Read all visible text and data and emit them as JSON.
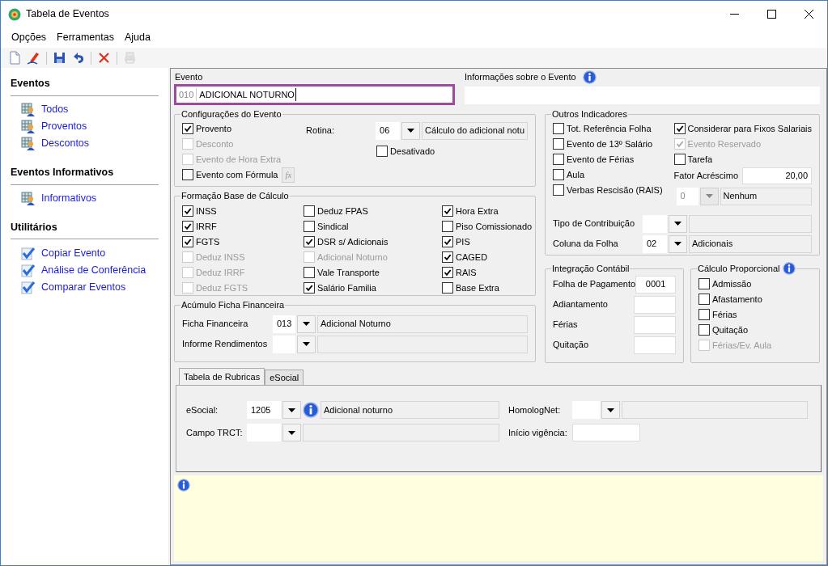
{
  "window": {
    "title": "Tabela de Eventos"
  },
  "menu": [
    "Opções",
    "Ferramentas",
    "Ajuda"
  ],
  "toolbar": [
    {
      "kind": "new",
      "disabled": false
    },
    {
      "kind": "edit",
      "disabled": false
    },
    {
      "kind": "sep"
    },
    {
      "kind": "save",
      "disabled": false
    },
    {
      "kind": "undo",
      "disabled": false
    },
    {
      "kind": "sep"
    },
    {
      "kind": "delete",
      "disabled": false
    },
    {
      "kind": "sep"
    },
    {
      "kind": "print",
      "disabled": true
    }
  ],
  "sidebar": {
    "sections": [
      {
        "title": "Eventos",
        "items": [
          {
            "label": "Todos",
            "kind": "table"
          },
          {
            "label": "Proventos",
            "kind": "table"
          },
          {
            "label": "Descontos",
            "kind": "table"
          }
        ]
      },
      {
        "title": "Eventos Informativos",
        "items": [
          {
            "label": "Informativos",
            "kind": "table"
          }
        ]
      },
      {
        "title": "Utilitários",
        "items": [
          {
            "label": "Copiar Evento",
            "kind": "check"
          },
          {
            "label": "Análise de Conferência",
            "kind": "check"
          },
          {
            "label": "Comparar Eventos",
            "kind": "check"
          }
        ]
      }
    ]
  },
  "evento": {
    "label": "Evento",
    "code": "010",
    "name": "ADICIONAL NOTURNO"
  },
  "info": {
    "label": "Informações sobre o Evento"
  },
  "config": {
    "title": "Configurações do Evento",
    "checkboxes": [
      {
        "label": "Provento",
        "checked": true,
        "disabled": false
      },
      {
        "label": "Desconto",
        "checked": false,
        "disabled": true
      },
      {
        "label": "Evento de Hora Extra",
        "checked": false,
        "disabled": true
      },
      {
        "label": "Evento com Fórmula",
        "checked": false,
        "disabled": false
      }
    ],
    "formula_button": "fx",
    "rotina": {
      "label": "Rotina:",
      "code": "06",
      "description": "Cálculo do adicional notu"
    },
    "desativado": {
      "label": "Desativado",
      "checked": false,
      "disabled": false
    }
  },
  "base": {
    "title": "Formação Base de Cálculo",
    "columns": [
      [
        {
          "label": "INSS",
          "checked": true,
          "disabled": false
        },
        {
          "label": "IRRF",
          "checked": true,
          "disabled": false
        },
        {
          "label": "FGTS",
          "checked": true,
          "disabled": false
        },
        {
          "label": "Deduz INSS",
          "checked": false,
          "disabled": true
        },
        {
          "label": "Deduz IRRF",
          "checked": false,
          "disabled": true
        },
        {
          "label": "Deduz FGTS",
          "checked": false,
          "disabled": true
        }
      ],
      [
        {
          "label": "Deduz FPAS",
          "checked": false,
          "disabled": false
        },
        {
          "label": "Sindical",
          "checked": false,
          "disabled": false
        },
        {
          "label": "DSR s/ Adicionais",
          "checked": true,
          "disabled": false
        },
        {
          "label": "Adicional Noturno",
          "checked": false,
          "disabled": true
        },
        {
          "label": "Vale Transporte",
          "checked": false,
          "disabled": false
        },
        {
          "label": "Salário Familia",
          "checked": true,
          "disabled": false
        }
      ],
      [
        {
          "label": "Hora Extra",
          "checked": true,
          "disabled": false
        },
        {
          "label": "Piso Comissionado",
          "checked": false,
          "disabled": false
        },
        {
          "label": "PIS",
          "checked": true,
          "disabled": false
        },
        {
          "label": "CAGED",
          "checked": true,
          "disabled": false
        },
        {
          "label": "RAIS",
          "checked": true,
          "disabled": false
        },
        {
          "label": "Base Extra",
          "checked": false,
          "disabled": false
        }
      ]
    ]
  },
  "acumulo": {
    "title": "Acúmulo Ficha Financeira",
    "rows": [
      {
        "label": "Ficha Financeira",
        "code": "013",
        "description": "Adicional Noturno"
      },
      {
        "label": "Informe Rendimentos"
      }
    ]
  },
  "outros": {
    "title": "Outros Indicadores",
    "left": [
      {
        "label": "Tot. Referência Folha",
        "checked": false,
        "disabled": false
      },
      {
        "label": "Evento de 13º Salário",
        "checked": false,
        "disabled": false
      },
      {
        "label": "Evento de Férias",
        "checked": false,
        "disabled": false
      },
      {
        "label": "Aula",
        "checked": false,
        "disabled": false
      },
      {
        "label": "Verbas Rescisão (RAIS)",
        "checked": false,
        "disabled": false
      }
    ],
    "right": [
      {
        "label": "Considerar para Fixos Salariais",
        "checked": true,
        "disabled": false
      },
      {
        "label": "Evento Reservado",
        "checked": true,
        "disabled": true
      },
      {
        "label": "Tarefa",
        "checked": false,
        "disabled": false
      }
    ],
    "fator": {
      "label": "Fator Acréscimo",
      "value": "20,00"
    },
    "combo": {
      "code": "0",
      "description": "Nenhum",
      "disabled": true
    },
    "rows": [
      {
        "label": "Tipo de Contribuição"
      },
      {
        "label": "Coluna da Folha",
        "code": "02",
        "description": "Adicionais"
      }
    ]
  },
  "integracao": {
    "title": "Integração Contábil",
    "rows": [
      {
        "label": "Folha de Pagamento",
        "value": "0001"
      },
      {
        "label": "Adiantamento"
      },
      {
        "label": "Férias"
      },
      {
        "label": "Quitação"
      }
    ]
  },
  "proporcional": {
    "title": "Cálculo Proporcional",
    "items": [
      {
        "label": "Admissão",
        "checked": false,
        "disabled": false
      },
      {
        "label": "Afastamento",
        "checked": false,
        "disabled": false
      },
      {
        "label": "Férias",
        "checked": false,
        "disabled": false
      },
      {
        "label": "Quitação",
        "checked": false,
        "disabled": false
      },
      {
        "label": "Férias/Ev. Aula",
        "checked": false,
        "disabled": true
      }
    ]
  },
  "tabs": [
    {
      "label": "Tabela de Rubricas",
      "selected": true
    },
    {
      "label": "eSocial",
      "selected": false
    }
  ],
  "rubricas": {
    "esocial": {
      "label": "eSocial:",
      "code": "1205",
      "description": "Adicional noturno"
    },
    "trct": {
      "label": "Campo TRCT:"
    },
    "homolognet": {
      "label": "HomologNet:"
    },
    "inicio": {
      "label": "Início vigência:"
    }
  }
}
